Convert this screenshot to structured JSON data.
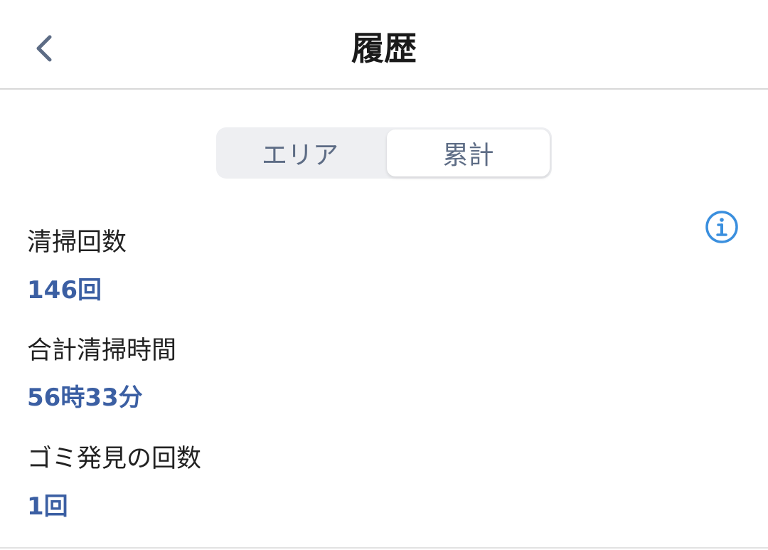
{
  "header": {
    "title": "履歴"
  },
  "segmented_control": {
    "tabs": [
      {
        "label": "エリア",
        "selected": false
      },
      {
        "label": "累計",
        "selected": true
      }
    ]
  },
  "stats": [
    {
      "label": "清掃回数",
      "value": "146回"
    },
    {
      "label": "合計清掃時間",
      "value": "56時33分"
    },
    {
      "label": "ゴミ発見の回数",
      "value": "1回"
    }
  ],
  "colors": {
    "accent_value": "#3b5fa3",
    "info_icon": "#3a8fde",
    "back_icon": "#5d6c85"
  },
  "icons": {
    "back": "chevron-left-icon",
    "info": "info-icon"
  }
}
